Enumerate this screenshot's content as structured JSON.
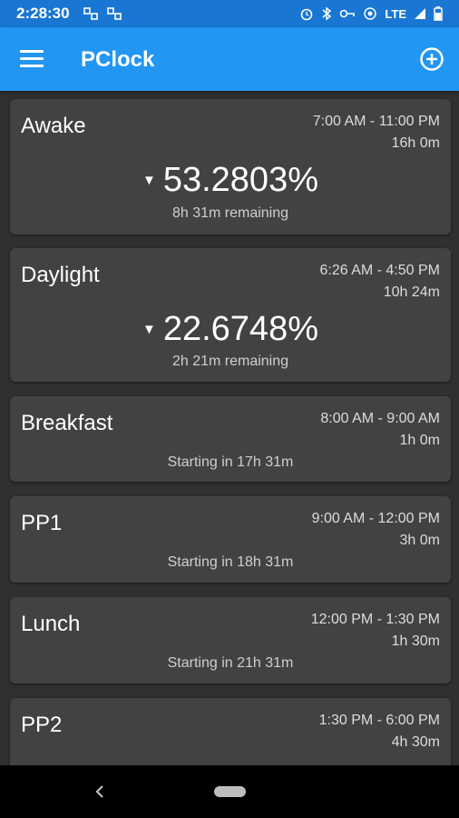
{
  "status_bar": {
    "time": "2:28:30",
    "network": "LTE"
  },
  "app_bar": {
    "title": "PClock"
  },
  "cards": [
    {
      "name": "Awake",
      "range": "7:00 AM - 11:00 PM",
      "duration": "16h 0m",
      "percent": "53.2803%",
      "status": "8h 31m remaining"
    },
    {
      "name": "Daylight",
      "range": "6:26 AM - 4:50 PM",
      "duration": "10h 24m",
      "percent": "22.6748%",
      "status": "2h 21m remaining"
    },
    {
      "name": "Breakfast",
      "range": "8:00 AM - 9:00 AM",
      "duration": "1h 0m",
      "status": "Starting in 17h 31m"
    },
    {
      "name": "PP1",
      "range": "9:00 AM - 12:00 PM",
      "duration": "3h 0m",
      "status": "Starting in 18h 31m"
    },
    {
      "name": "Lunch",
      "range": "12:00 PM - 1:30 PM",
      "duration": "1h 30m",
      "status": "Starting in 21h 31m"
    },
    {
      "name": "PP2",
      "range": "1:30 PM - 6:00 PM",
      "duration": "4h 30m",
      "status": ""
    }
  ],
  "colors": {
    "status_bar": "#1976d2",
    "app_bar": "#2196f3",
    "background": "#303030",
    "card": "#424242"
  },
  "icons": {
    "menu": "menu-icon",
    "add": "add-circle-icon",
    "trend": "triangle-down-icon",
    "back": "back-icon",
    "home": "home-pill-icon"
  }
}
